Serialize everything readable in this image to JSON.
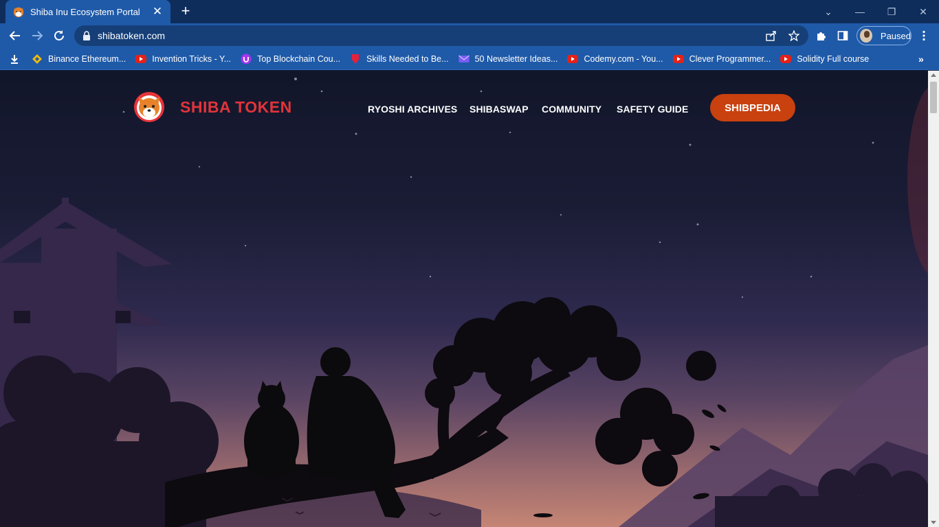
{
  "browser": {
    "tab": {
      "title": "Shiba Inu Ecosystem Portal"
    },
    "address_bar": {
      "url": "shibatoken.com"
    },
    "profile": {
      "label": "Paused"
    },
    "bookmarks": [
      {
        "label": "Binance Ethereum...",
        "icon": "binance-icon"
      },
      {
        "label": "Invention Tricks - Y...",
        "icon": "youtube-icon"
      },
      {
        "label": "Top Blockchain Cou...",
        "icon": "udemy-icon"
      },
      {
        "label": "Skills Needed to Be...",
        "icon": "shield-icon"
      },
      {
        "label": "50 Newsletter Ideas...",
        "icon": "mail-icon"
      },
      {
        "label": "Codemy.com - You...",
        "icon": "youtube-icon"
      },
      {
        "label": "Clever Programmer...",
        "icon": "youtube-icon"
      },
      {
        "label": "Solidity Full course",
        "icon": "youtube-icon"
      }
    ]
  },
  "site": {
    "brand": "SHIBA TOKEN",
    "nav": {
      "ryoshi": "RYOSHI ARCHIVES",
      "shibaswap": "SHIBASWAP",
      "community": "COMMUNITY",
      "safety": "SAFETY GUIDE",
      "cta": "SHIBPEDIA"
    }
  },
  "colors": {
    "brand_red": "#e2343a",
    "cta_orange": "#c9410f",
    "chrome_blue": "#1f5aa8"
  }
}
